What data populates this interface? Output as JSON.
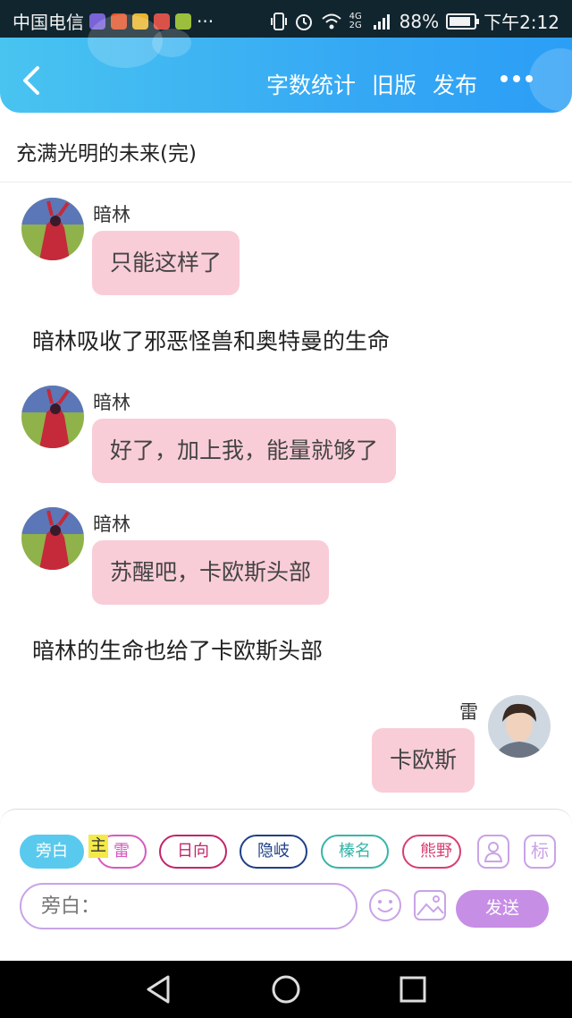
{
  "status_bar": {
    "carrier": "中国电信",
    "more": "···",
    "network": "4G 2G",
    "battery_level": 0.88,
    "battery": "88%",
    "time": "下午2:12"
  },
  "header": {
    "actions": [
      "字数统计",
      "旧版",
      "发布"
    ]
  },
  "title": "充满光明的未来(完)",
  "messages": [
    {
      "type": "left",
      "name": "暗林",
      "text": "只能这样了"
    },
    {
      "type": "narration",
      "text": "暗林吸收了邪恶怪兽和奥特曼的生命"
    },
    {
      "type": "left",
      "name": "暗林",
      "text": "好了，加上我，能量就够了"
    },
    {
      "type": "left",
      "name": "暗林",
      "text": "苏醒吧，卡欧斯头部"
    },
    {
      "type": "narration",
      "text": "暗林的生命也给了卡欧斯头部"
    },
    {
      "type": "right",
      "name": "雷",
      "text": "卡欧斯"
    }
  ],
  "composer": {
    "main_tag": "主",
    "chips": [
      {
        "label": "旁白",
        "color": "#5ac9ee",
        "active": true
      },
      {
        "label": "雷",
        "color": "#d65ac0",
        "active": false
      },
      {
        "label": "日向",
        "color": "#c2256a",
        "active": false
      },
      {
        "label": "隐岐",
        "color": "#1f3f87",
        "active": false
      },
      {
        "label": "榛名",
        "color": "#37b5a8",
        "active": false
      },
      {
        "label": "熊野",
        "color": "#d6406f",
        "active": false
      }
    ],
    "tag_icon": "标",
    "input_placeholder": "旁白：",
    "send_label": "发送"
  },
  "colors": {
    "header_gradient": [
      "#49c4f0",
      "#2b9ef6"
    ],
    "bubble": "#f9cdd8",
    "accent_purple": "#c78ee6"
  }
}
